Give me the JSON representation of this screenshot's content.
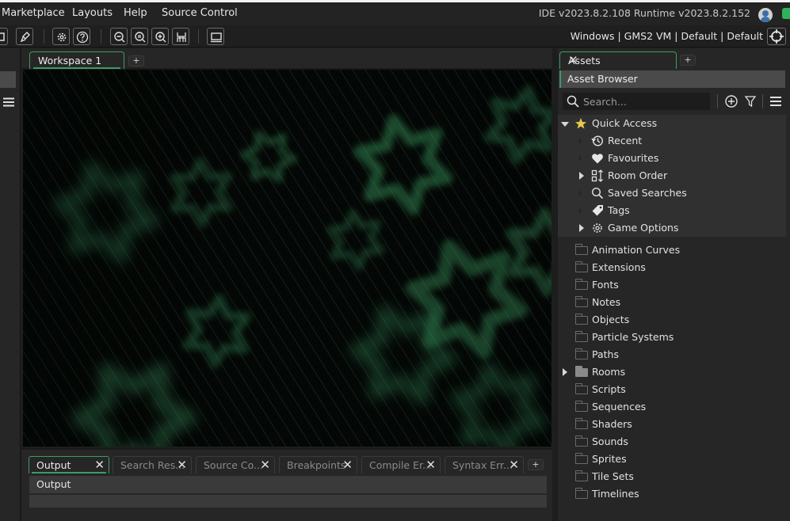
{
  "menubar": {
    "items": [
      "Marketplace",
      "Layouts",
      "Help",
      "Source Control"
    ],
    "version": "IDE v2023.8.2.108  Runtime v2023.8.2.152"
  },
  "toolbar": {
    "target": "Windows | GMS2 VM | Default | Default"
  },
  "workspace": {
    "tab_label": "Workspace 1",
    "add_tab": "+"
  },
  "output": {
    "tabs": [
      "Output",
      "Search Res...",
      "Source Co...",
      "Breakpoints",
      "Compile Er...",
      "Syntax Err..."
    ],
    "add_tab": "+",
    "title": "Output"
  },
  "assets": {
    "tab_label": "Assets",
    "add_tab": "+",
    "browser_title": "Asset Browser",
    "search_placeholder": "Search...",
    "quick_access": {
      "label": "Quick Access",
      "items": [
        "Recent",
        "Favourites",
        "Room Order",
        "Saved Searches",
        "Tags",
        "Game Options"
      ]
    },
    "folders": [
      "Animation Curves",
      "Extensions",
      "Fonts",
      "Notes",
      "Objects",
      "Particle Systems",
      "Paths",
      "Rooms",
      "Scripts",
      "Sequences",
      "Shaders",
      "Sounds",
      "Sprites",
      "Tile Sets",
      "Timelines"
    ]
  },
  "colors": {
    "accent": "#3a9d64",
    "background": "#262626",
    "canvas": "#040705"
  }
}
